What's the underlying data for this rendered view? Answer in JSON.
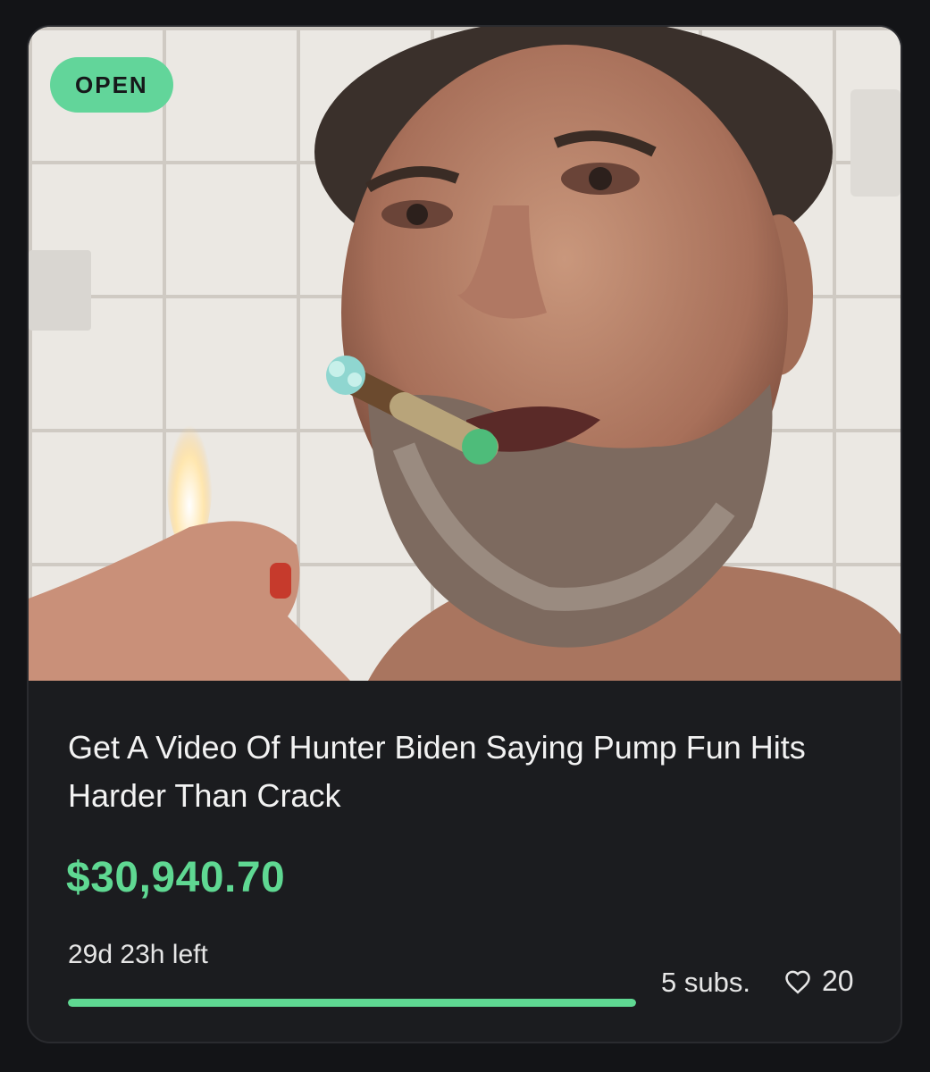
{
  "card": {
    "status_badge": "OPEN",
    "title": "Get A Video Of Hunter Biden Saying Pump Fun Hits Harder Than Crack",
    "amount": "$30,940.70",
    "time_left": "29d 23h left",
    "progress_fraction": 1.0,
    "subscribers": "5 subs.",
    "likes": "20"
  },
  "colors": {
    "accent_green": "#5fd892",
    "badge_green": "#62d59a",
    "card_bg": "#1b1c1f",
    "page_bg": "#131417"
  },
  "icons": {
    "like": "heart-outline-icon"
  }
}
